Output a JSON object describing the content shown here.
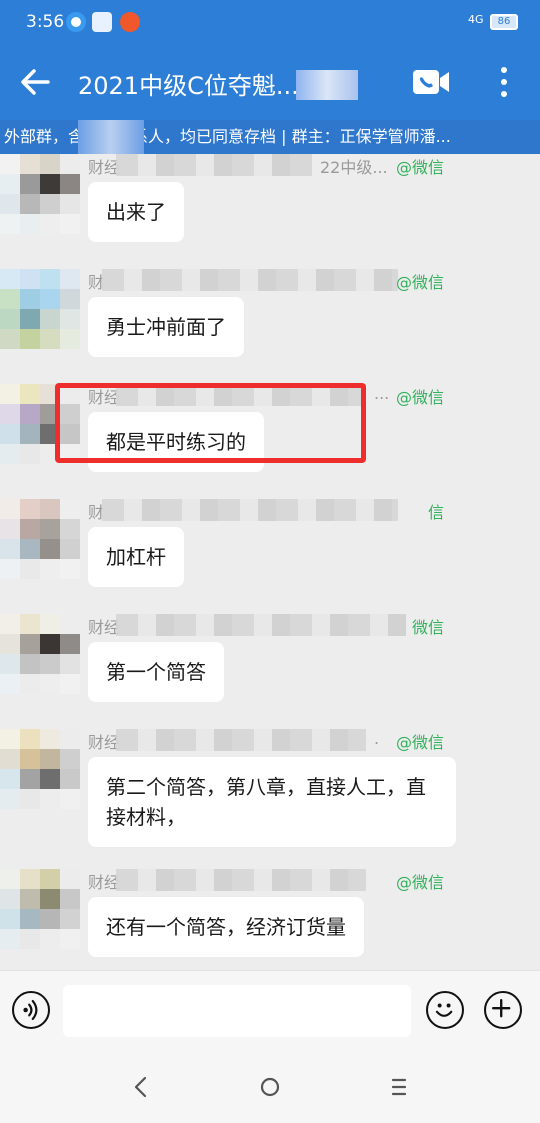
{
  "status_bar": {
    "time": "3:56",
    "signal": "4G",
    "battery": "86"
  },
  "app_bar": {
    "title": "2021中级C位夺魁..."
  },
  "banner": {
    "text": "外部群，含外部联系人，均已同意存档 | 群主：正保学管师潘..."
  },
  "colors": {
    "primary": "#2d7ed6",
    "source": "#33b15d",
    "highlight": "#ee2d2d"
  },
  "messages": [
    {
      "sender": "财经",
      "group_snippet": "22中级...",
      "source": "@微信",
      "text": "出来了"
    },
    {
      "sender": "财",
      "group_snippet": "",
      "source": "@微信",
      "text": "勇士冲前面了"
    },
    {
      "sender": "财经",
      "group_snippet": "...",
      "source": "@微信",
      "text": "都是平时练习的"
    },
    {
      "sender": "财",
      "group_snippet": "",
      "source": "信",
      "text": "加杠杆"
    },
    {
      "sender": "财经",
      "group_snippet": "",
      "source": "微信",
      "text": "第一个简答"
    },
    {
      "sender": "财经",
      "group_snippet": ".",
      "source": "@微信",
      "text": "第二个简答，第八章，直接人工，直接材料，"
    },
    {
      "sender": "财经",
      "group_snippet": "",
      "source": "@微信",
      "text": "还有一个简答，经济订货量"
    }
  ],
  "input": {
    "placeholder": ""
  },
  "icons": {
    "back": "arrow-left-icon",
    "video": "video-call-icon",
    "more": "more-vertical-icon",
    "voice": "voice-icon",
    "emoji": "emoji-icon",
    "plus": "plus-icon",
    "nav_back": "nav-back-icon",
    "nav_home": "nav-home-icon",
    "nav_menu": "nav-menu-icon"
  }
}
